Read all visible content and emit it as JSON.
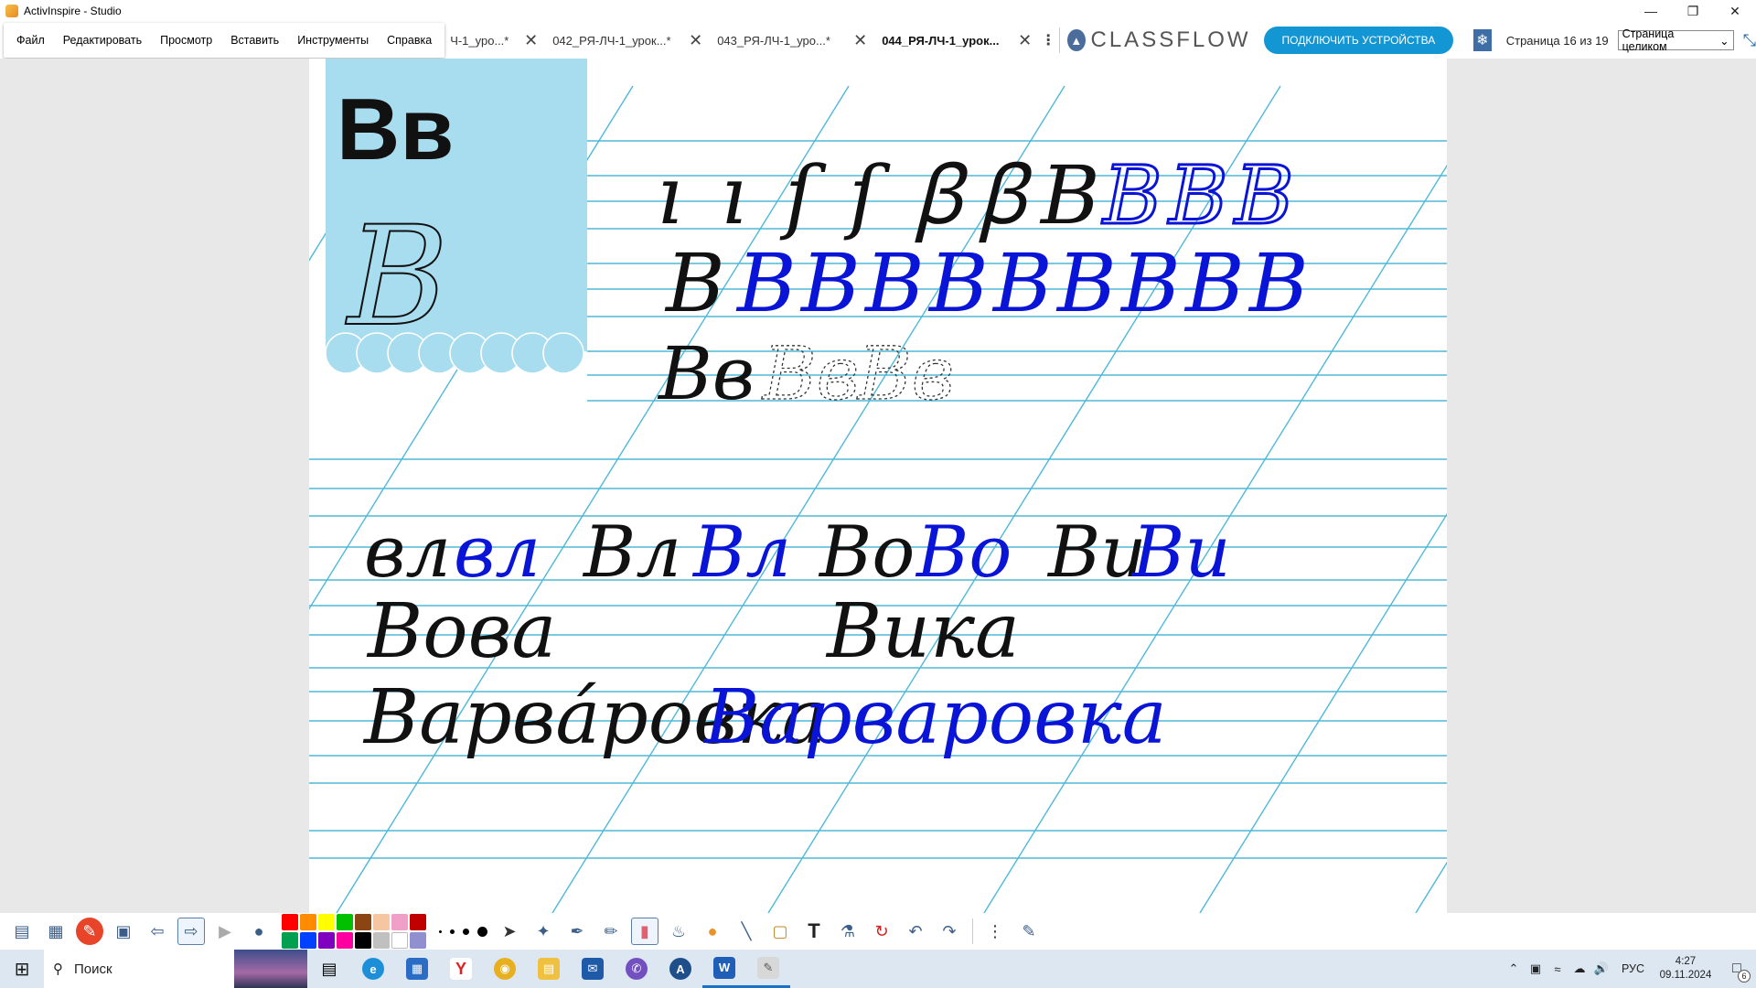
{
  "window": {
    "title": "ActivInspire - Studio"
  },
  "menu": {
    "items": [
      "Файл",
      "Редактировать",
      "Просмотр",
      "Вставить",
      "Инструменты",
      "Справка"
    ]
  },
  "tabs": [
    {
      "label": "Ч-1_уро...*"
    },
    {
      "label": "042_РЯ-ЛЧ-1_урок...*"
    },
    {
      "label": "043_РЯ-ЛЧ-1_уро...*"
    },
    {
      "label": "044_РЯ-ЛЧ-1_урок..."
    }
  ],
  "classflow": {
    "brand": "CLASSFLOW",
    "connect_label": "ПОДКЛЮЧИТЬ УСТРОЙСТВА"
  },
  "page_nav": {
    "page_text": "Страница 16 из 19",
    "zoom_value": "Страница целиком"
  },
  "worksheet": {
    "letter_print": "Вв",
    "row1_black": [
      "ı",
      "ı",
      "ſ",
      "ſ",
      "ꞵ",
      "ꞵ",
      "В"
    ],
    "row1_blue": [
      "В",
      "В",
      "В"
    ],
    "row2_black": "В",
    "row2_blue": [
      "В",
      "В",
      "В",
      "В",
      "В",
      "В",
      "В",
      "В",
      "В"
    ],
    "row3_black": "Вв",
    "row3_dotted": [
      "Вв",
      "Вв"
    ],
    "row4": [
      {
        "text": "вл",
        "color": "black"
      },
      {
        "text": "вл",
        "color": "blue"
      },
      {
        "text": "Вл",
        "color": "black"
      },
      {
        "text": "Вл",
        "color": "blue"
      },
      {
        "text": "Во",
        "color": "black"
      },
      {
        "text": "Во",
        "color": "blue"
      },
      {
        "text": "Ви",
        "color": "black"
      },
      {
        "text": "Ви",
        "color": "blue"
      }
    ],
    "word_vova": "Вова",
    "word_vika": "Вика",
    "word_varvarovka_print": "Варва́ровка",
    "word_varvarovka_blue": "Варваровка",
    "ink_blue": "#0a14d6",
    "line_blue": "#4fb8d9",
    "card_blue": "#a8dcef"
  },
  "toolbar": {
    "colors": [
      "#ff0000",
      "#ff8c00",
      "#ffff00",
      "#00c000",
      "#8b4513",
      "#f5c6a0",
      "#f0a0c8",
      "#c00000",
      "#00a050",
      "#0040ff",
      "#8000c0",
      "#ff00a0",
      "#000000",
      "#c0c0c0",
      "#ffffff",
      "#9090d0"
    ]
  },
  "taskbar": {
    "search_placeholder": "Поиск",
    "lang": "РУС",
    "time": "4:27",
    "date": "09.11.2024",
    "notifications": "6"
  }
}
